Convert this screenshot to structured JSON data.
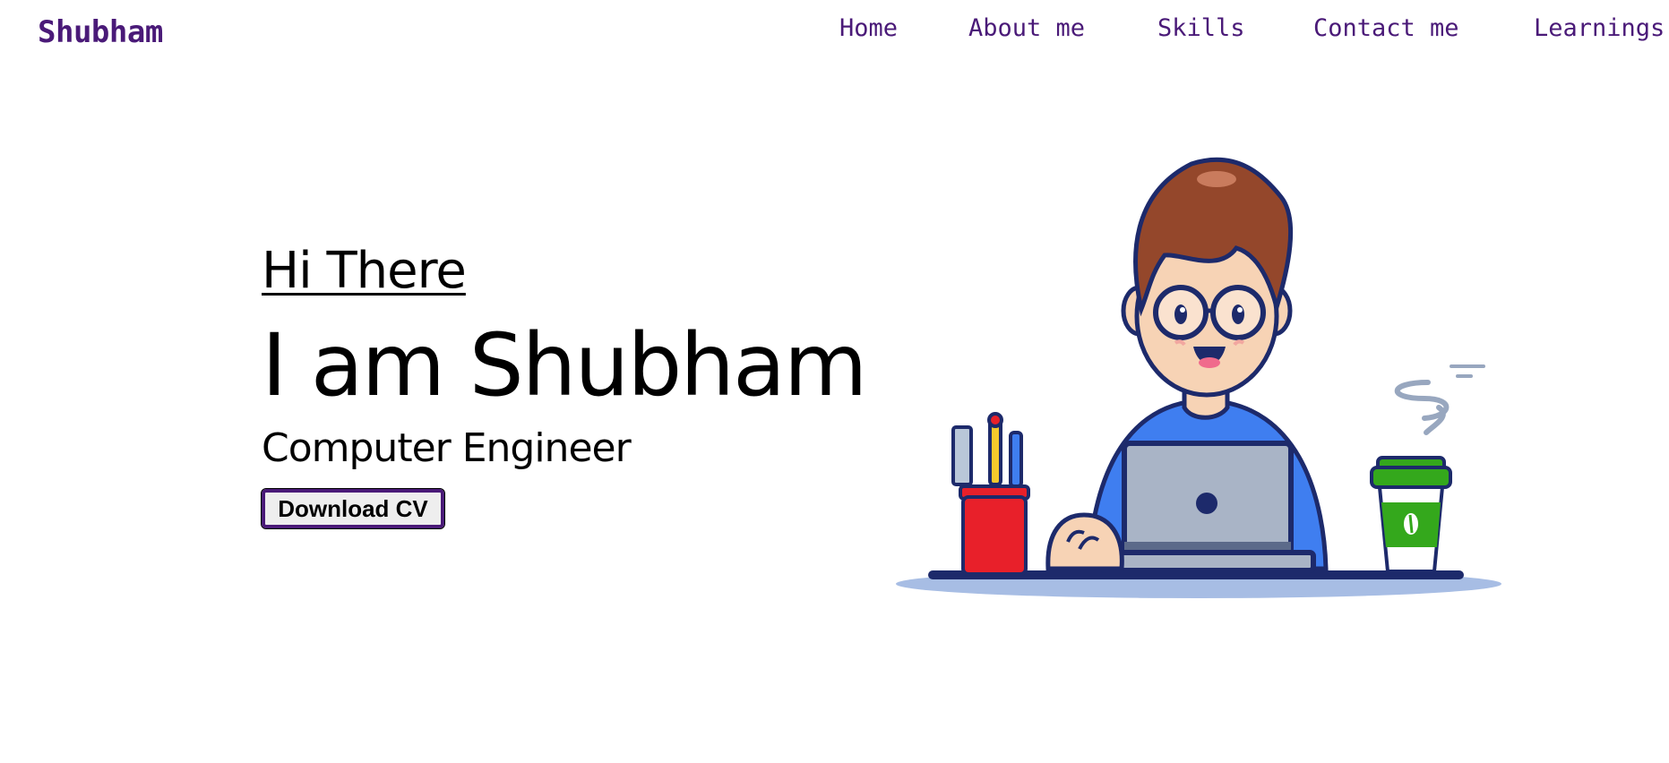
{
  "header": {
    "brand": "Shubham",
    "nav": [
      {
        "label": "Home"
      },
      {
        "label": "About me"
      },
      {
        "label": "Skills"
      },
      {
        "label": "Contact me"
      },
      {
        "label": "Learnings"
      }
    ]
  },
  "hero": {
    "greeting": "Hi There",
    "headline": "I am Shubham",
    "role": "Computer Engineer",
    "cta_label": "Download CV",
    "illustration": "developer-at-laptop-illustration"
  },
  "colors": {
    "brand": "#4a1a78",
    "text": "#000000",
    "background": "#ffffff",
    "shirt": "#3f7ef0",
    "hair": "#94472b",
    "cup": "#e8202a",
    "coffee_sleeve": "#34a81c"
  }
}
